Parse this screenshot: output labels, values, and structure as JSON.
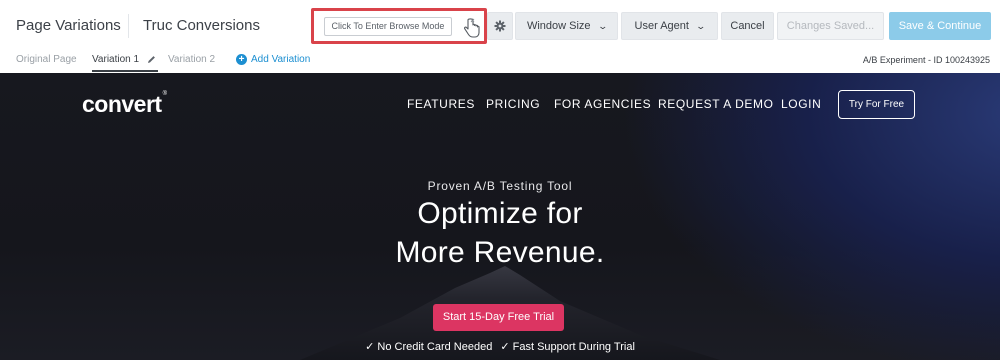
{
  "header": {
    "title": "Page Variations",
    "project": "Truc Conversions",
    "browse_mode_label": "Click To Enter Browse Mode",
    "window_size_label": "Window Size",
    "user_agent_label": "User Agent",
    "cancel_label": "Cancel",
    "changes_saved_label": "Changes Saved...",
    "save_label": "Save & Continue",
    "chevron": "⌄"
  },
  "tabs": {
    "items": [
      "Original Page",
      "Variation 1",
      "Variation 2"
    ],
    "add_label": "Add Variation",
    "add_symbol": "+",
    "experiment_id": "A/B Experiment - ID 100243925"
  },
  "site": {
    "logo": "convert",
    "logo_mark": "®",
    "nav": [
      "FEATURES",
      "PRICING",
      "FOR AGENCIES",
      "REQUEST A DEMO",
      "LOGIN"
    ],
    "cta_nav": "Try For Free",
    "eyebrow": "Proven A/B Testing Tool",
    "headline_line1": "Optimize for",
    "headline_line2": "More Revenue.",
    "cta": "Start 15-Day Free Trial",
    "perks": [
      "✓ No Credit Card Needed",
      "✓ Fast Support During Trial"
    ]
  },
  "colors": {
    "highlight": "#d9434a",
    "primary_button": "#8ccbe9",
    "link_blue": "#1c8fd1",
    "cta_pink": "#dc3562",
    "hero_background": "#15161c"
  },
  "icons": {
    "settings": "gear-icon",
    "browse_pointer": "hand-pointer-icon",
    "edit": "pencil-icon",
    "add": "plus-circle-icon"
  }
}
